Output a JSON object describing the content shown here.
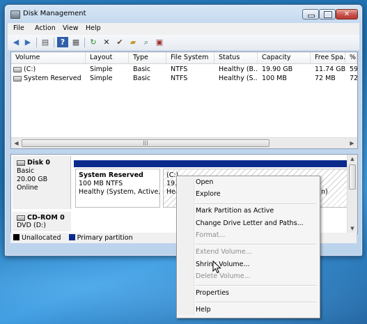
{
  "window": {
    "title": "Disk Management"
  },
  "menu": [
    "File",
    "Action",
    "View",
    "Help"
  ],
  "volume_list": {
    "columns": [
      "Volume",
      "Layout",
      "Type",
      "File System",
      "Status",
      "Capacity",
      "Free Spa...",
      "% F"
    ],
    "rows": [
      [
        "(C:)",
        "Simple",
        "Basic",
        "NTFS",
        "Healthy (B...",
        "19.90 GB",
        "11.74 GB",
        "59"
      ],
      [
        "System Reserved",
        "Simple",
        "Basic",
        "NTFS",
        "Healthy (S...",
        "100 MB",
        "72 MB",
        "72"
      ]
    ]
  },
  "disk0": {
    "name": "Disk 0",
    "type": "Basic",
    "size": "20.00 GB",
    "state": "Online",
    "partitions": [
      {
        "name": "System Reserved",
        "size_fs": "100 MB NTFS",
        "status": "Healthy (System, Active, Pr"
      },
      {
        "name": "(C:)",
        "size_fs": "19.90",
        "status": "Healt",
        "status_tail": "n)"
      }
    ]
  },
  "cdrom": {
    "name": "CD-ROM 0",
    "type": "DVD (D:)"
  },
  "legend": {
    "unallocated": "Unallocated",
    "primary": "Primary partition"
  },
  "colors": {
    "primary": "#0a2a8c",
    "unallocated": "#000000"
  },
  "context_menu": {
    "items": [
      {
        "label": "Open",
        "enabled": true
      },
      {
        "label": "Explore",
        "enabled": true
      },
      {
        "label": "Mark Partition as Active",
        "enabled": true
      },
      {
        "label": "Change Drive Letter and Paths...",
        "enabled": true
      },
      {
        "label": "Format...",
        "enabled": false
      },
      {
        "label": "Extend Volume...",
        "enabled": false
      },
      {
        "label": "Shrink Volume...",
        "enabled": true
      },
      {
        "label": "Delete Volume...",
        "enabled": false
      },
      {
        "label": "Properties",
        "enabled": true
      },
      {
        "label": "Help",
        "enabled": true
      }
    ]
  }
}
